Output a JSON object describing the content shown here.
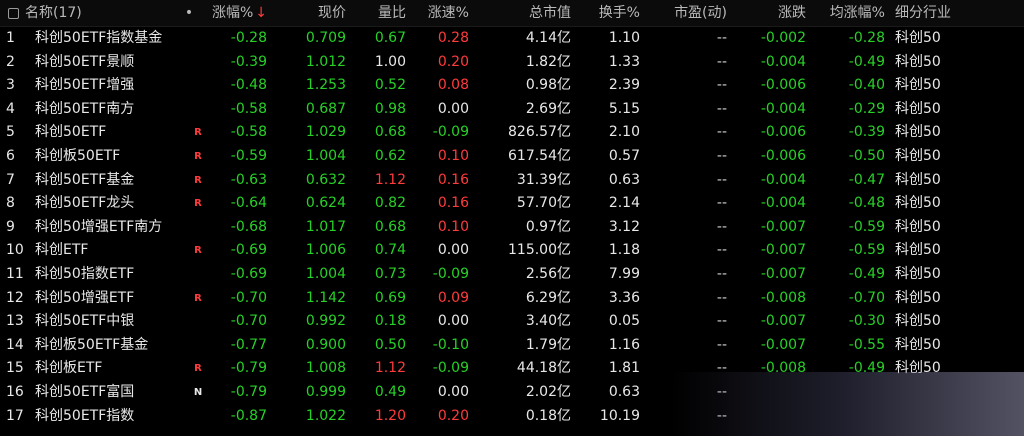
{
  "header": {
    "name": "名称(17)",
    "dot": "•",
    "pct": "涨幅%",
    "sort_arrow": "↓",
    "price": "现价",
    "vol_ratio": "量比",
    "speed": "涨速%",
    "mktcap": "总市值",
    "turnover": "换手%",
    "pe": "市盈(动)",
    "change": "涨跌",
    "avg_pct": "均涨幅%",
    "industry": "细分行业"
  },
  "colors": {
    "up": "#ff3b3b",
    "down": "#27d127",
    "neutral": "#e8e8e8",
    "background": "#000000"
  },
  "rows": [
    {
      "idx": "1",
      "name": "科创50ETF指数基金",
      "badge": "",
      "pct": "-0.28",
      "price": "0.709",
      "vol": "0.67",
      "vol_dir": "down",
      "speed": "0.28",
      "speed_dir": "up",
      "cap": "4.14亿",
      "turn": "1.10",
      "pe": "--",
      "chg": "-0.002",
      "avg": "-0.28",
      "ind": "科创50"
    },
    {
      "idx": "2",
      "name": "科创50ETF景顺",
      "badge": "",
      "pct": "-0.39",
      "price": "1.012",
      "vol": "1.00",
      "vol_dir": "neutral",
      "speed": "0.20",
      "speed_dir": "up",
      "cap": "1.82亿",
      "turn": "1.33",
      "pe": "--",
      "chg": "-0.004",
      "avg": "-0.49",
      "ind": "科创50"
    },
    {
      "idx": "3",
      "name": "科创50ETF增强",
      "badge": "",
      "pct": "-0.48",
      "price": "1.253",
      "vol": "0.52",
      "vol_dir": "down",
      "speed": "0.08",
      "speed_dir": "up",
      "cap": "0.98亿",
      "turn": "2.39",
      "pe": "--",
      "chg": "-0.006",
      "avg": "-0.40",
      "ind": "科创50"
    },
    {
      "idx": "4",
      "name": "科创50ETF南方",
      "badge": "",
      "pct": "-0.58",
      "price": "0.687",
      "vol": "0.98",
      "vol_dir": "down",
      "speed": "0.00",
      "speed_dir": "neutral",
      "cap": "2.69亿",
      "turn": "5.15",
      "pe": "--",
      "chg": "-0.004",
      "avg": "-0.29",
      "ind": "科创50"
    },
    {
      "idx": "5",
      "name": "科创50ETF",
      "badge": "R",
      "pct": "-0.58",
      "price": "1.029",
      "vol": "0.68",
      "vol_dir": "down",
      "speed": "-0.09",
      "speed_dir": "down",
      "cap": "826.57亿",
      "turn": "2.10",
      "pe": "--",
      "chg": "-0.006",
      "avg": "-0.39",
      "ind": "科创50"
    },
    {
      "idx": "6",
      "name": "科创板50ETF",
      "badge": "R",
      "pct": "-0.59",
      "price": "1.004",
      "vol": "0.62",
      "vol_dir": "down",
      "speed": "0.10",
      "speed_dir": "up",
      "cap": "617.54亿",
      "turn": "0.57",
      "pe": "--",
      "chg": "-0.006",
      "avg": "-0.50",
      "ind": "科创50"
    },
    {
      "idx": "7",
      "name": "科创50ETF基金",
      "badge": "R",
      "pct": "-0.63",
      "price": "0.632",
      "vol": "1.12",
      "vol_dir": "up",
      "speed": "0.16",
      "speed_dir": "up",
      "cap": "31.39亿",
      "turn": "0.63",
      "pe": "--",
      "chg": "-0.004",
      "avg": "-0.47",
      "ind": "科创50"
    },
    {
      "idx": "8",
      "name": "科创50ETF龙头",
      "badge": "R",
      "pct": "-0.64",
      "price": "0.624",
      "vol": "0.82",
      "vol_dir": "down",
      "speed": "0.16",
      "speed_dir": "up",
      "cap": "57.70亿",
      "turn": "2.14",
      "pe": "--",
      "chg": "-0.004",
      "avg": "-0.48",
      "ind": "科创50"
    },
    {
      "idx": "9",
      "name": "科创50增强ETF南方",
      "badge": "",
      "pct": "-0.68",
      "price": "1.017",
      "vol": "0.68",
      "vol_dir": "down",
      "speed": "0.10",
      "speed_dir": "up",
      "cap": "0.97亿",
      "turn": "3.12",
      "pe": "--",
      "chg": "-0.007",
      "avg": "-0.59",
      "ind": "科创50"
    },
    {
      "idx": "10",
      "name": "科创ETF",
      "badge": "R",
      "pct": "-0.69",
      "price": "1.006",
      "vol": "0.74",
      "vol_dir": "down",
      "speed": "0.00",
      "speed_dir": "neutral",
      "cap": "115.00亿",
      "turn": "1.18",
      "pe": "--",
      "chg": "-0.007",
      "avg": "-0.59",
      "ind": "科创50"
    },
    {
      "idx": "11",
      "name": "科创50指数ETF",
      "badge": "",
      "pct": "-0.69",
      "price": "1.004",
      "vol": "0.73",
      "vol_dir": "down",
      "speed": "-0.09",
      "speed_dir": "down",
      "cap": "2.56亿",
      "turn": "7.99",
      "pe": "--",
      "chg": "-0.007",
      "avg": "-0.49",
      "ind": "科创50"
    },
    {
      "idx": "12",
      "name": "科创50增强ETF",
      "badge": "R",
      "pct": "-0.70",
      "price": "1.142",
      "vol": "0.69",
      "vol_dir": "down",
      "speed": "0.09",
      "speed_dir": "up",
      "cap": "6.29亿",
      "turn": "3.36",
      "pe": "--",
      "chg": "-0.008",
      "avg": "-0.70",
      "ind": "科创50"
    },
    {
      "idx": "13",
      "name": "科创50ETF中银",
      "badge": "",
      "pct": "-0.70",
      "price": "0.992",
      "vol": "0.18",
      "vol_dir": "down",
      "speed": "0.00",
      "speed_dir": "neutral",
      "cap": "3.40亿",
      "turn": "0.05",
      "pe": "--",
      "chg": "-0.007",
      "avg": "-0.30",
      "ind": "科创50"
    },
    {
      "idx": "14",
      "name": "科创板50ETF基金",
      "badge": "",
      "pct": "-0.77",
      "price": "0.900",
      "vol": "0.50",
      "vol_dir": "down",
      "speed": "-0.10",
      "speed_dir": "down",
      "cap": "1.79亿",
      "turn": "1.16",
      "pe": "--",
      "chg": "-0.007",
      "avg": "-0.55",
      "ind": "科创50"
    },
    {
      "idx": "15",
      "name": "科创板ETF",
      "badge": "R",
      "pct": "-0.79",
      "price": "1.008",
      "vol": "1.12",
      "vol_dir": "up",
      "speed": "-0.09",
      "speed_dir": "down",
      "cap": "44.18亿",
      "turn": "1.81",
      "pe": "--",
      "chg": "-0.008",
      "avg": "-0.49",
      "ind": "科创50"
    },
    {
      "idx": "16",
      "name": "科创50ETF富国",
      "badge": "N",
      "pct": "-0.79",
      "price": "0.999",
      "vol": "0.49",
      "vol_dir": "down",
      "speed": "0.00",
      "speed_dir": "neutral",
      "cap": "2.02亿",
      "turn": "0.63",
      "pe": "--",
      "chg": "",
      "avg": "",
      "ind": ""
    },
    {
      "idx": "17",
      "name": "科创50ETF指数",
      "badge": "",
      "pct": "-0.87",
      "price": "1.022",
      "vol": "1.20",
      "vol_dir": "up",
      "speed": "0.20",
      "speed_dir": "up",
      "cap": "0.18亿",
      "turn": "10.19",
      "pe": "--",
      "chg": "",
      "avg": "",
      "ind": ""
    }
  ]
}
